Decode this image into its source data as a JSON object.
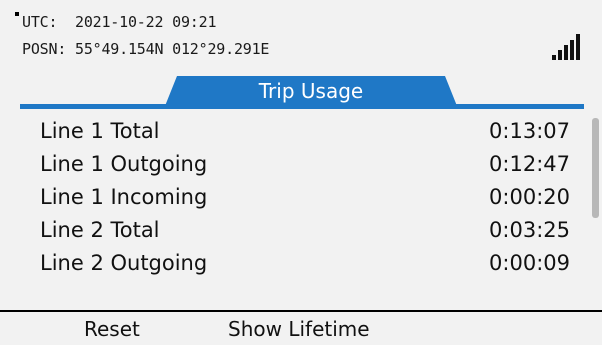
{
  "status": {
    "utc_line": "UTC:  2021-10-22 09:21",
    "posn_line": "POSN: 55°49.154N 012°29.291E",
    "signal_icon": "signal-strength-icon"
  },
  "header": {
    "title": "Trip Usage"
  },
  "rows": [
    {
      "label": "Line 1 Total",
      "value": "0:13:07"
    },
    {
      "label": "Line 1 Outgoing",
      "value": "0:12:47"
    },
    {
      "label": "Line 1 Incoming",
      "value": "0:00:20"
    },
    {
      "label": "Line 2 Total",
      "value": "0:03:25"
    },
    {
      "label": "Line 2 Outgoing",
      "value": "0:00:09"
    }
  ],
  "softkeys": {
    "left": "Reset",
    "right": "Show Lifetime"
  },
  "colors": {
    "accent": "#1f78c6",
    "background": "#f2f2f2",
    "text": "#111111"
  }
}
